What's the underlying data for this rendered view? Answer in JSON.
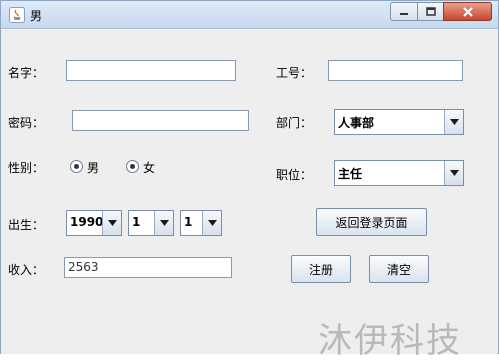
{
  "window": {
    "title": "男"
  },
  "form": {
    "name_label": "名字：",
    "name_value": "",
    "staffno_label": "工号：",
    "staffno_value": "",
    "password_label": "密码：",
    "password_value": "",
    "dept_label": "部门：",
    "dept_value": "人事部",
    "gender_label": "性别：",
    "gender_male": "男",
    "gender_female": "女",
    "position_label": "职位：",
    "position_value": "主任",
    "birth_label": "出生：",
    "birth_year": "1990",
    "birth_month": "1",
    "birth_day": "1",
    "income_label": "收入：",
    "income_value": "2563"
  },
  "buttons": {
    "back_login": "返回登录页面",
    "register": "注册",
    "clear": "清空"
  },
  "watermark": "沐伊科技"
}
